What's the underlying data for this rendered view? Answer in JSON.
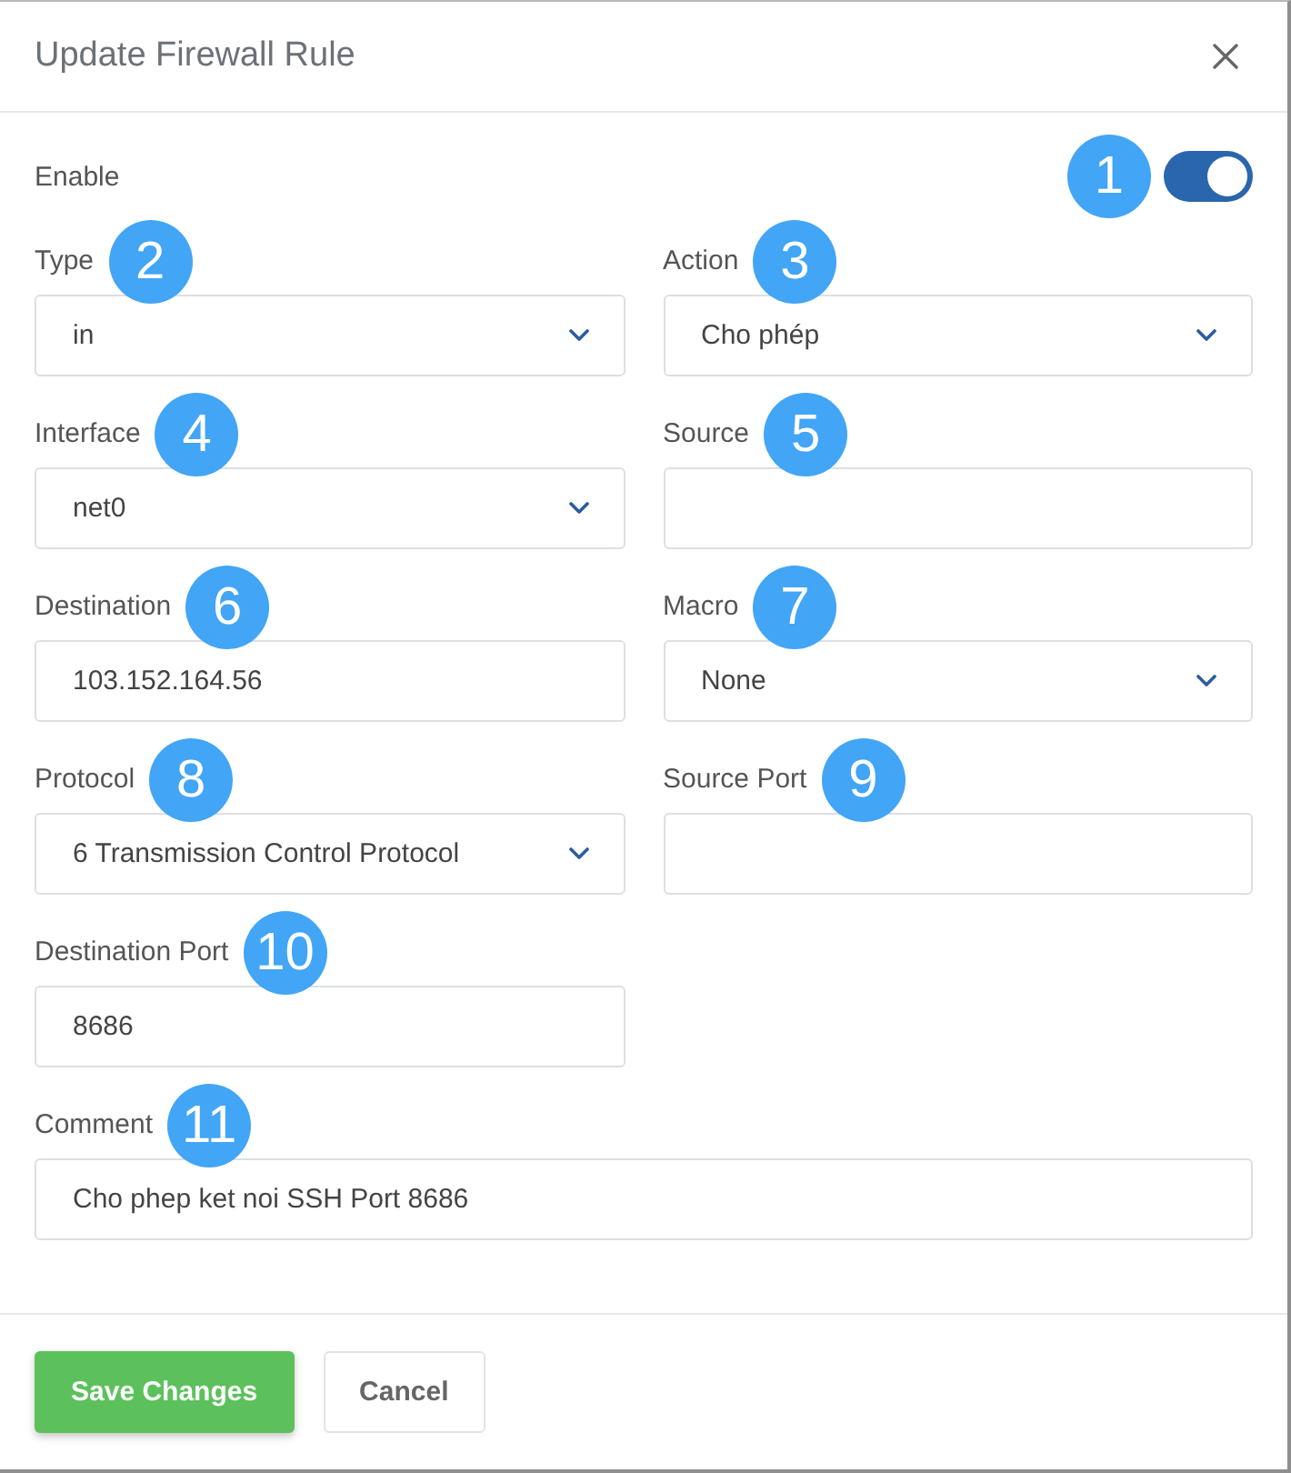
{
  "dialog": {
    "title": "Update Firewall Rule"
  },
  "enable": {
    "label": "Enable",
    "on": true,
    "callout": "1"
  },
  "fields": [
    {
      "kind": "select",
      "label": "Type",
      "value": "in",
      "callout": "2"
    },
    {
      "kind": "select",
      "label": "Action",
      "value": "Cho phép",
      "callout": "3"
    },
    {
      "kind": "select",
      "label": "Interface",
      "value": "net0",
      "callout": "4"
    },
    {
      "kind": "text",
      "label": "Source",
      "callout": "5"
    },
    {
      "kind": "text",
      "label": "Destination",
      "value": "103.152.164.56",
      "callout": "6"
    },
    {
      "kind": "select",
      "label": "Macro",
      "value": "None",
      "callout": "7"
    },
    {
      "kind": "select",
      "label": "Protocol",
      "value": "6 Transmission Control Protocol",
      "callout": "8"
    },
    {
      "kind": "text",
      "label": "Source Port",
      "callout": "9"
    },
    {
      "kind": "text",
      "label": "Destination Port",
      "value": "8686",
      "callout": "10"
    }
  ],
  "comment": {
    "kind": "text",
    "label": "Comment",
    "value": "Cho phep ket noi SSH Port 8686",
    "callout": "11"
  },
  "buttons": [
    {
      "kind": "primary",
      "label": "Save Changes"
    },
    {
      "kind": "secondary",
      "label": "Cancel"
    }
  ]
}
